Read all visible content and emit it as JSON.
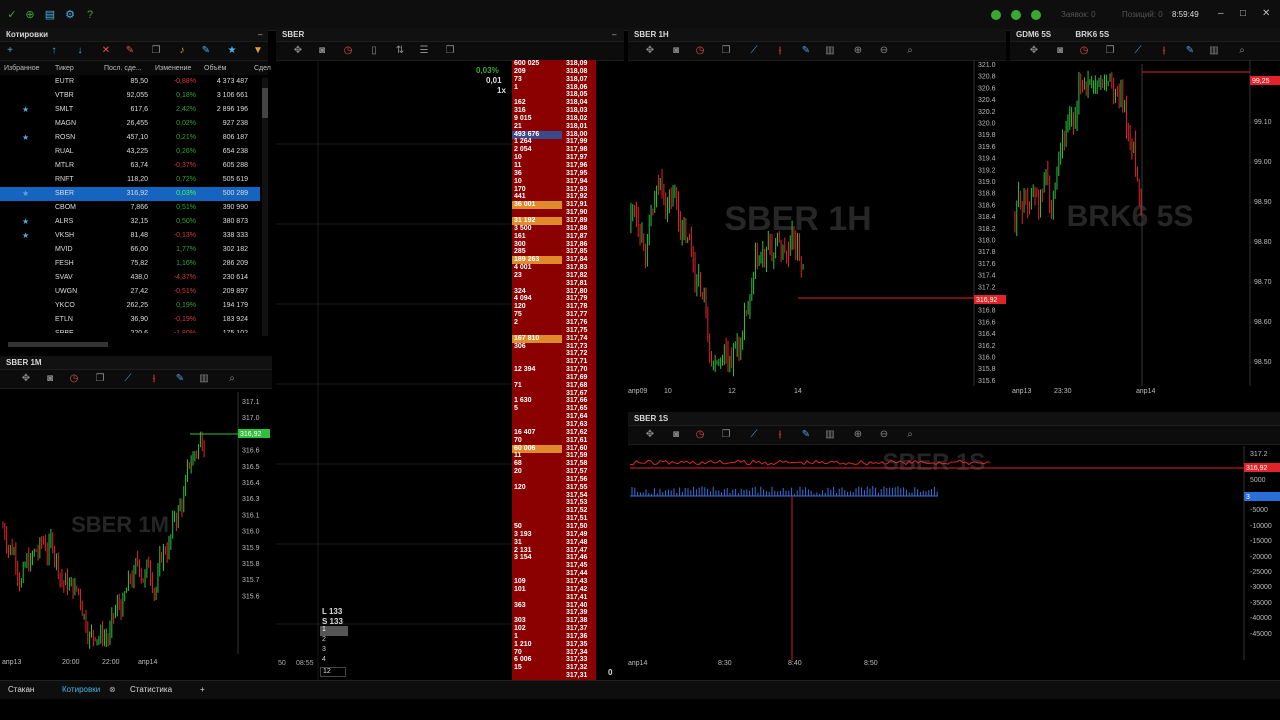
{
  "topbar": {
    "orders_label": "Заявок: 0",
    "positions_label": "Позиций: 0",
    "clock": "8:59:49"
  },
  "quotes": {
    "title": "Котировки",
    "headers": [
      "Избранное",
      "Тикер",
      "Посл. сде...",
      "Изменение",
      "Объём",
      "Сдел"
    ],
    "rows": [
      {
        "fav": false,
        "ticker": "EUTR",
        "last": "85,50",
        "change": "-0,88%",
        "volume": "4 373 487",
        "up": false
      },
      {
        "fav": false,
        "ticker": "VTBR",
        "last": "92,055",
        "change": "0,18%",
        "volume": "3 106 661",
        "up": true
      },
      {
        "fav": true,
        "ticker": "SMLT",
        "last": "617,6",
        "change": "2,42%",
        "volume": "2 896 196",
        "up": true
      },
      {
        "fav": false,
        "ticker": "MAGN",
        "last": "26,455",
        "change": "0,02%",
        "volume": "927 238",
        "up": true
      },
      {
        "fav": true,
        "ticker": "ROSN",
        "last": "457,10",
        "change": "0,21%",
        "volume": "806 187",
        "up": true
      },
      {
        "fav": false,
        "ticker": "RUAL",
        "last": "43,225",
        "change": "0,26%",
        "volume": "654 238",
        "up": true
      },
      {
        "fav": false,
        "ticker": "MTLR",
        "last": "63,74",
        "change": "-0,37%",
        "volume": "605 288",
        "up": false
      },
      {
        "fav": false,
        "ticker": "RNFT",
        "last": "118,20",
        "change": "0,72%",
        "volume": "505 619",
        "up": true
      },
      {
        "fav": true,
        "ticker": "SBER",
        "last": "316,92",
        "change": "0,03%",
        "volume": "500 289",
        "up": true,
        "selected": true
      },
      {
        "fav": false,
        "ticker": "CBOM",
        "last": "7,866",
        "change": "0,51%",
        "volume": "390 990",
        "up": true
      },
      {
        "fav": true,
        "ticker": "ALRS",
        "last": "32,15",
        "change": "0,50%",
        "volume": "380 873",
        "up": true
      },
      {
        "fav": true,
        "ticker": "VKSH",
        "last": "81,48",
        "change": "-0,13%",
        "volume": "338 333",
        "up": false
      },
      {
        "fav": false,
        "ticker": "MVID",
        "last": "66,00",
        "change": "1,77%",
        "volume": "302 182",
        "up": true
      },
      {
        "fav": false,
        "ticker": "FESH",
        "last": "75,82",
        "change": "1,16%",
        "volume": "286 209",
        "up": true
      },
      {
        "fav": false,
        "ticker": "SVAV",
        "last": "438,0",
        "change": "-4,37%",
        "volume": "230 614",
        "up": false
      },
      {
        "fav": false,
        "ticker": "UWGN",
        "last": "27,42",
        "change": "-0,51%",
        "volume": "209 897",
        "up": false
      },
      {
        "fav": false,
        "ticker": "YKCO",
        "last": "262,25",
        "change": "0,19%",
        "volume": "194 179",
        "up": true
      },
      {
        "fav": false,
        "ticker": "ETLN",
        "last": "36,90",
        "change": "-0,19%",
        "volume": "183 924",
        "up": false
      },
      {
        "fav": false,
        "ticker": "SPBE",
        "last": "220,6",
        "change": "-1,80%",
        "volume": "175 102",
        "up": false
      }
    ]
  },
  "sber1m": {
    "tab": "SBER 1M",
    "watermark": "SBER 1M",
    "price_tag": "316,92",
    "y_labels": [
      "317.1",
      "317.0",
      "316.8",
      "316.6",
      "316.5",
      "316.4",
      "316.3",
      "316.1",
      "316.0",
      "315.9",
      "315.8",
      "315.7",
      "315.6"
    ],
    "x_labels": [
      "апр13",
      "20:00",
      "22:00",
      "апр14"
    ]
  },
  "orderbook": {
    "tab": "SBER",
    "pct": "0,03%",
    "step": "0,01",
    "mult": "1x",
    "ls_long": "L 133",
    "ls_short": "S 133",
    "qty_options": [
      "1",
      "2",
      "3",
      "4",
      "12"
    ],
    "time_left": "50",
    "time_mid": "08:55",
    "zero": "0",
    "rows": [
      [
        "600 025",
        "318,09"
      ],
      [
        "209",
        "318,08"
      ],
      [
        "73",
        "318,07"
      ],
      [
        "1",
        "318,06"
      ],
      [
        "",
        "318,05"
      ],
      [
        "162",
        "318,04"
      ],
      [
        "316",
        "318,03"
      ],
      [
        "9 015",
        "318,02"
      ],
      [
        "21",
        "318,01"
      ],
      [
        "493 676",
        "318,00"
      ],
      [
        "1 264",
        "317,99"
      ],
      [
        "2 054",
        "317,98"
      ],
      [
        "10",
        "317,97"
      ],
      [
        "11",
        "317,96"
      ],
      [
        "36",
        "317,95"
      ],
      [
        "10",
        "317,94"
      ],
      [
        "170",
        "317,93"
      ],
      [
        "441",
        "317,92"
      ],
      [
        "36 001",
        "317,91"
      ],
      [
        "",
        "317,90"
      ],
      [
        "31 192",
        "317,89"
      ],
      [
        "3 500",
        "317,88"
      ],
      [
        "161",
        "317,87"
      ],
      [
        "300",
        "317,86"
      ],
      [
        "285",
        "317,85"
      ],
      [
        "189 263",
        "317,84"
      ],
      [
        "4 001",
        "317,83"
      ],
      [
        "23",
        "317,82"
      ],
      [
        "",
        "317,81"
      ],
      [
        "324",
        "317,80"
      ],
      [
        "4 094",
        "317,79"
      ],
      [
        "120",
        "317,78"
      ],
      [
        "75",
        "317,77"
      ],
      [
        "2",
        "317,76"
      ],
      [
        "",
        "317,75"
      ],
      [
        "167 810",
        "317,74"
      ],
      [
        "306",
        "317,73"
      ],
      [
        "",
        "317,72"
      ],
      [
        "",
        "317,71"
      ],
      [
        "12 394",
        "317,70"
      ],
      [
        "",
        "317,69"
      ],
      [
        "71",
        "317,68"
      ],
      [
        "",
        "317,67"
      ],
      [
        "1 630",
        "317,66"
      ],
      [
        "5",
        "317,65"
      ],
      [
        "",
        "317,64"
      ],
      [
        "",
        "317,63"
      ],
      [
        "16 407",
        "317,62"
      ],
      [
        "70",
        "317,61"
      ],
      [
        "60 006",
        "317,60"
      ],
      [
        "11",
        "317,59"
      ],
      [
        "68",
        "317,58"
      ],
      [
        "20",
        "317,57"
      ],
      [
        "",
        "317,56"
      ],
      [
        "120",
        "317,55"
      ],
      [
        "",
        "317,54"
      ],
      [
        "",
        "317,53"
      ],
      [
        "",
        "317,52"
      ],
      [
        "",
        "317,51"
      ],
      [
        "50",
        "317,50"
      ],
      [
        "3 193",
        "317,49"
      ],
      [
        "31",
        "317,48"
      ],
      [
        "2 131",
        "317,47"
      ],
      [
        "3 154",
        "317,46"
      ],
      [
        "",
        "317,45"
      ],
      [
        "",
        "317,44"
      ],
      [
        "109",
        "317,43"
      ],
      [
        "101",
        "317,42"
      ],
      [
        "",
        "317,41"
      ],
      [
        "363",
        "317,40"
      ],
      [
        "",
        "317,39"
      ],
      [
        "303",
        "317,38"
      ],
      [
        "102",
        "317,37"
      ],
      [
        "1",
        "317,36"
      ],
      [
        "1 210",
        "317,35"
      ],
      [
        "70",
        "317,34"
      ],
      [
        "6 006",
        "317,33"
      ],
      [
        "15",
        "317,32"
      ],
      [
        "",
        "317,31"
      ]
    ]
  },
  "sber1h": {
    "tab": "SBER 1H",
    "watermark": "SBER 1H",
    "price_tag": "316,92",
    "y_labels": [
      "321.0",
      "320.8",
      "320.6",
      "320.4",
      "320.2",
      "320.0",
      "319.8",
      "319.6",
      "319.4",
      "319.2",
      "319.0",
      "318.8",
      "318.6",
      "318.4",
      "318.2",
      "318.0",
      "317.8",
      "317.6",
      "317.4",
      "317.2",
      "317.0",
      "316.8",
      "316.6",
      "316.4",
      "316.2",
      "316.0",
      "315.8",
      "315.6"
    ],
    "x_labels": [
      "апр09",
      "10",
      "12",
      "14"
    ]
  },
  "tabs_right": {
    "gdm": "GDM6 5S",
    "brk": "BRK6 5S"
  },
  "brk": {
    "watermark": "BRK6 5S",
    "price_tag": "99,25",
    "y_labels": [
      "99.25",
      "99.10",
      "99.00",
      "98.90",
      "98.80",
      "98.70",
      "98.60",
      "98.50"
    ],
    "x_labels": [
      "апр13",
      "23:30",
      "апр14"
    ]
  },
  "sber1s": {
    "tab": "SBER 1S",
    "watermark": "SBER 1S",
    "price_tag": "316,92",
    "vol_tag": "3",
    "y_labels": [
      "317.2",
      "5000",
      "-5000",
      "-10000",
      "-15000",
      "-20000",
      "-25000",
      "-30000",
      "-35000",
      "-40000",
      "-45000"
    ],
    "x_labels": [
      "апр14",
      "8:30",
      "8:40",
      "8:50"
    ]
  },
  "bottom_tabs": [
    "Стакан",
    "Котировки",
    "Статистика"
  ]
}
